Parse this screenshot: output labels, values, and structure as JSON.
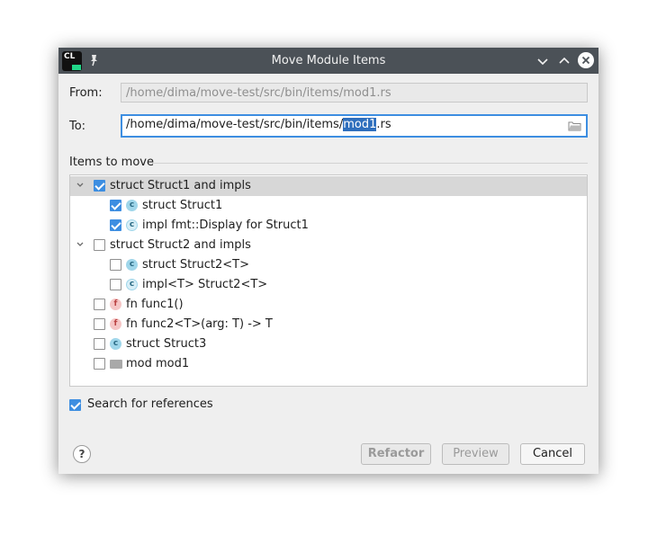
{
  "window": {
    "title": "Move Module Items",
    "app_icon_text": "CL"
  },
  "form": {
    "from_label": "From:",
    "from_value": "/home/dima/move-test/src/bin/items/mod1.rs",
    "to_label": "To:",
    "to_value_prefix": "/home/dima/move-test/src/bin/items/",
    "to_value_selected": "mod1",
    "to_value_suffix": ".rs"
  },
  "items_section": {
    "title": "Items to move"
  },
  "tree": [
    {
      "label": "struct Struct1 and impls",
      "checked": true,
      "expanded": true,
      "icon": "none",
      "selected": true
    },
    {
      "label": "struct Struct1",
      "checked": true,
      "icon": "c"
    },
    {
      "label": "impl fmt::Display for Struct1",
      "checked": true,
      "icon": "impl"
    },
    {
      "label": "struct Struct2 and impls",
      "checked": false,
      "expanded": true,
      "icon": "none"
    },
    {
      "label": "struct Struct2<T>",
      "checked": false,
      "icon": "c"
    },
    {
      "label": "impl<T> Struct2<T>",
      "checked": false,
      "icon": "impl"
    },
    {
      "label": "fn func1()",
      "checked": false,
      "icon": "f"
    },
    {
      "label": "fn func2<T>(arg: T) -> T",
      "checked": false,
      "icon": "f"
    },
    {
      "label": "struct Struct3",
      "checked": false,
      "icon": "c"
    },
    {
      "label": "mod mod1",
      "checked": false,
      "icon": "mod"
    }
  ],
  "options": {
    "search_refs_label": "Search for references",
    "search_refs_checked": true
  },
  "buttons": {
    "refactor": "Refactor",
    "preview": "Preview",
    "cancel": "Cancel",
    "help": "?"
  },
  "colors": {
    "accent": "#3d8ee1",
    "titlebar": "#4b5157",
    "selection": "#2f6fbd"
  }
}
